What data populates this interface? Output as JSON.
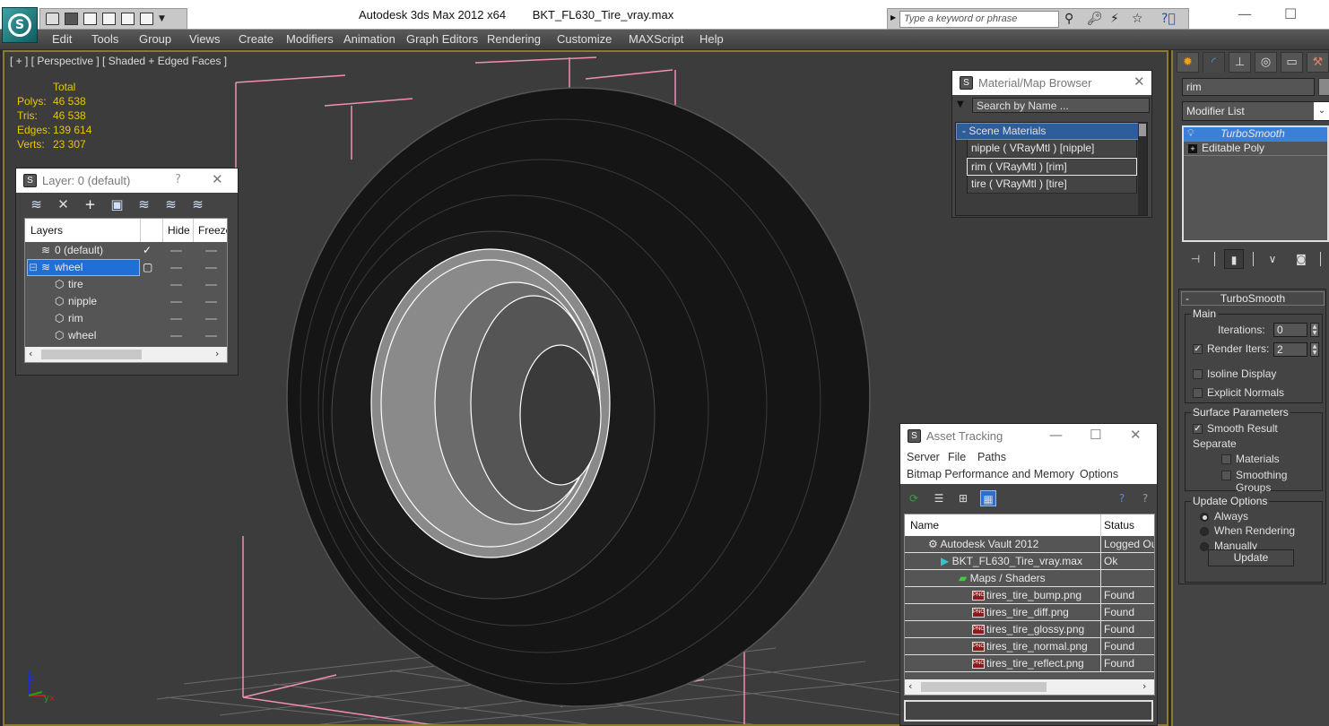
{
  "window": {
    "app_title": "Autodesk 3ds Max  2012 x64",
    "file_title": "BKT_FL630_Tire_vray.max",
    "search_placeholder": "Type a keyword or phrase",
    "controls": [
      "minimize",
      "maximize",
      "close"
    ]
  },
  "quick_access": [
    "open-file-icon",
    "save-icon",
    "new-icon",
    "reference-icon",
    "blank-icon",
    "blank-icon",
    "dropdown-icon"
  ],
  "menu": [
    "Edit",
    "Tools",
    "Group",
    "Views",
    "Create",
    "Modifiers",
    "Animation",
    "Graph Editors",
    "Rendering",
    "Customize",
    "MAXScript",
    "Help"
  ],
  "viewport": {
    "label": "[ + ] [ Perspective ] [ Shaded + Edged Faces ]",
    "stats": {
      "header": "Total",
      "rows": [
        {
          "k": "Polys:",
          "v": "46 538"
        },
        {
          "k": "Tris:",
          "v": "46 538"
        },
        {
          "k": "Edges:",
          "v": "139 614"
        },
        {
          "k": "Verts:",
          "v": "23 307"
        }
      ]
    },
    "axis": {
      "z": "z",
      "y": "y",
      "x": "x"
    }
  },
  "layer_dialog": {
    "title": "Layer: 0 (default)",
    "help": "?",
    "columns": [
      "Layers",
      "Hide",
      "Freeze"
    ],
    "rows": [
      {
        "name": "0 (default)",
        "indent": 1,
        "type": "layer",
        "current": true
      },
      {
        "name": "wheel",
        "indent": 0,
        "type": "layer",
        "selected": true,
        "expanded": true
      },
      {
        "name": "tire",
        "indent": 2,
        "type": "object"
      },
      {
        "name": "nipple",
        "indent": 2,
        "type": "object"
      },
      {
        "name": "rim",
        "indent": 2,
        "type": "object"
      },
      {
        "name": "wheel",
        "indent": 2,
        "type": "object"
      }
    ]
  },
  "material_browser": {
    "title": "Material/Map Browser",
    "search_placeholder": "Search by Name ...",
    "group": "Scene Materials",
    "items": [
      {
        "label": "nipple  ( VRayMtl )  [nipple]"
      },
      {
        "label": "rim  ( VRayMtl )  [rim]",
        "selected": true
      },
      {
        "label": "tire  ( VRayMtl )  [tire]"
      }
    ]
  },
  "command_panel": {
    "tabs": [
      "create",
      "modify",
      "hierarchy",
      "motion",
      "display",
      "utilities"
    ],
    "object_name": "rim",
    "modifier_list": "Modifier List",
    "stack": [
      {
        "label": "TurboSmooth",
        "selected": true
      },
      {
        "label": "Editable Poly"
      }
    ],
    "turbosmooth": {
      "title": "TurboSmooth",
      "main_label": "Main",
      "iterations_label": "Iterations:",
      "iterations": "0",
      "render_iters_label": "Render Iters:",
      "render_iters": "2",
      "render_iters_checked": true,
      "isoline_label": "Isoline Display",
      "explicit_normals_label": "Explicit Normals",
      "surface_label": "Surface Parameters",
      "smooth_result_label": "Smooth Result",
      "separate_label": "Separate",
      "materials_label": "Materials",
      "smoothing_groups_label": "Smoothing Groups",
      "update_options_label": "Update Options",
      "always_label": "Always",
      "when_rendering_label": "When Rendering",
      "manually_label": "Manually",
      "update_button": "Update",
      "update_selected": "Always"
    }
  },
  "asset_tracking": {
    "title": "Asset Tracking",
    "menu_row1": [
      "Server",
      "File",
      "Paths"
    ],
    "menu_row2": [
      "Bitmap Performance and Memory",
      "Options"
    ],
    "columns": [
      "Name",
      "Status"
    ],
    "rows": [
      {
        "name": "Autodesk Vault 2012",
        "status": "Logged Ou",
        "indent": 1,
        "icon": "vault-icon"
      },
      {
        "name": "BKT_FL630_Tire_vray.max",
        "status": "Ok",
        "indent": 2,
        "icon": "max-file-icon"
      },
      {
        "name": "Maps / Shaders",
        "status": "",
        "indent": 3,
        "icon": "maps-icon"
      },
      {
        "name": "tires_tire_bump.png",
        "status": "Found",
        "indent": 4,
        "icon": "png-icon"
      },
      {
        "name": "tires_tire_diff.png",
        "status": "Found",
        "indent": 4,
        "icon": "png-icon"
      },
      {
        "name": "tires_tire_glossy.png",
        "status": "Found",
        "indent": 4,
        "icon": "png-icon"
      },
      {
        "name": "tires_tire_normal.png",
        "status": "Found",
        "indent": 4,
        "icon": "png-icon"
      },
      {
        "name": "tires_tire_reflect.png",
        "status": "Found",
        "indent": 4,
        "icon": "png-icon"
      }
    ]
  }
}
